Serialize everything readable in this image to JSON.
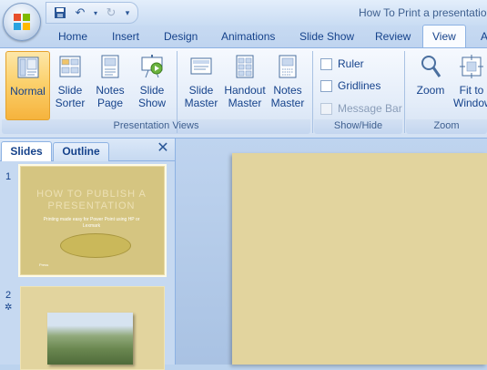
{
  "window": {
    "title": "How To Print a presentatio"
  },
  "qat": {
    "save_icon": "save-icon",
    "undo_icon": "undo-icon",
    "redo_icon": "redo-icon",
    "customize_icon": "customize-qat-icon"
  },
  "tabs": [
    "Home",
    "Insert",
    "Design",
    "Animations",
    "Slide Show",
    "Review",
    "View",
    "A"
  ],
  "active_tab": "View",
  "ribbon": {
    "presentation_views": {
      "label": "Presentation Views",
      "buttons": [
        {
          "l1": "Normal",
          "l2": ""
        },
        {
          "l1": "Slide",
          "l2": "Sorter"
        },
        {
          "l1": "Notes",
          "l2": "Page"
        },
        {
          "l1": "Slide",
          "l2": "Show"
        },
        {
          "l1": "Slide",
          "l2": "Master"
        },
        {
          "l1": "Handout",
          "l2": "Master"
        },
        {
          "l1": "Notes",
          "l2": "Master"
        }
      ]
    },
    "show_hide": {
      "label": "Show/Hide",
      "ruler": "Ruler",
      "gridlines": "Gridlines",
      "message_bar": "Message Bar"
    },
    "zoom": {
      "label": "Zoom",
      "zoom_button": "Zoom",
      "fit_l1": "Fit to",
      "fit_l2": "Window"
    }
  },
  "panel": {
    "tab_slides": "Slides",
    "tab_outline": "Outline",
    "close": "✕",
    "slides": [
      {
        "number": "1",
        "title": "HOW TO PUBLISH A PRESENTATION",
        "subtitle": "Printing made easy for Power Point using HP or Lexmark",
        "footer": "Press"
      },
      {
        "number": "2"
      }
    ]
  },
  "colors": {
    "accent": "#f6b33d",
    "ribbon_text": "#15428b",
    "slide_bg": "#e2d49e"
  }
}
